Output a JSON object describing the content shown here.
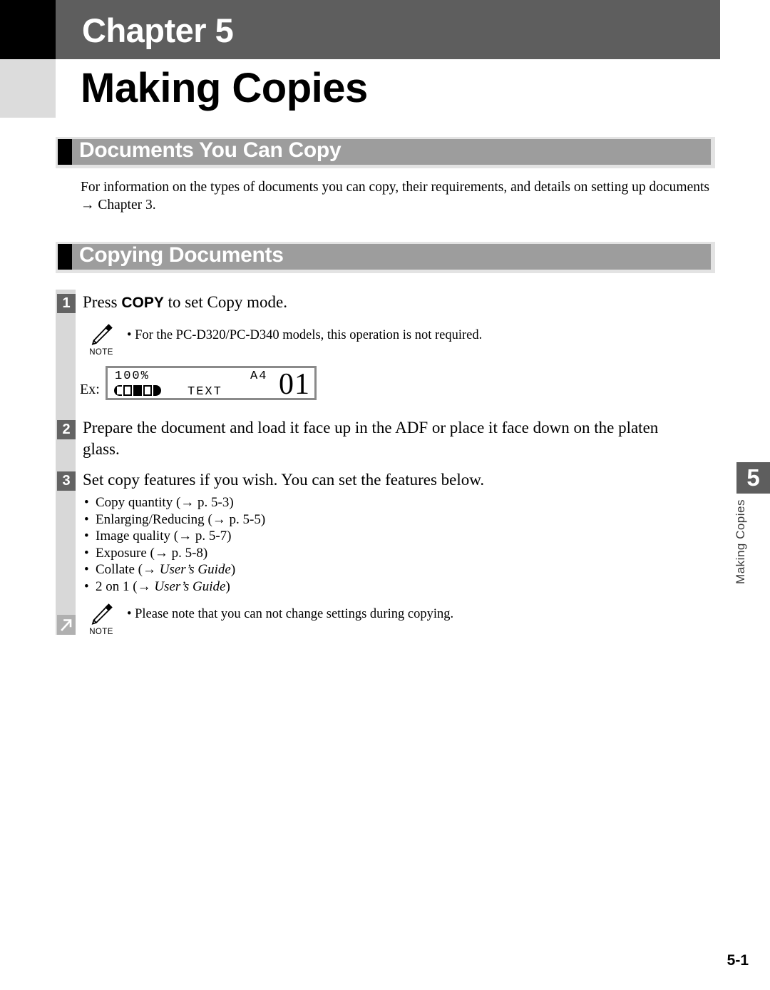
{
  "header": {
    "chapter_label": "Chapter 5",
    "title": "Making Copies"
  },
  "sections": [
    {
      "heading": "Documents You Can Copy",
      "paragraph_line1": "For information on the types of documents you can copy, their requirements, and details on setting up documents",
      "paragraph_line2": "→ Chapter 3."
    },
    {
      "heading": "Copying Documents"
    }
  ],
  "steps": [
    {
      "number": "1",
      "text_before": "Press ",
      "text_bold": "COPY",
      "text_after": " to set Copy mode."
    },
    {
      "number": "2",
      "text": "Prepare the document and load it face up in the ADF or place it face down on the platen glass."
    },
    {
      "number": "3",
      "text": "Set copy features if you wish. You can set the features below."
    }
  ],
  "notes": [
    {
      "icon": "pencil-icon",
      "label": "NOTE",
      "text": "• For the PC-D320/PC-D340 models, this operation is not required."
    },
    {
      "icon": "pencil-icon",
      "label": "NOTE",
      "text": "• Please note that you can not change settings during copying."
    }
  ],
  "lcd_example": {
    "ex_label": "Ex:",
    "zoom_value": "100%",
    "paper_size": "A4",
    "copy_count": "01",
    "image_mode": "TEXT",
    "density_scale": [
      "cap-left",
      "open",
      "filled",
      "open",
      "cap-right"
    ]
  },
  "feature_bullets": [
    {
      "bullet": "•",
      "label": "Copy quantity",
      "ref": "(→ p. 5-3)",
      "ref_italic": false
    },
    {
      "bullet": "•",
      "label": "Enlarging/Reducing",
      "ref": "(→ p. 5-5)",
      "ref_italic": false
    },
    {
      "bullet": "•",
      "label": "Image quality",
      "ref": "(→ p. 5-7)",
      "ref_italic": false
    },
    {
      "bullet": "•",
      "label": "Exposure",
      "ref": "(→ p. 5-8)",
      "ref_italic": false
    },
    {
      "bullet": "•",
      "label": "Collate",
      "ref_prefix": "(→ ",
      "ref_italic_text": "User’s Guide",
      "ref_suffix": ")",
      "ref_italic": true
    },
    {
      "bullet": "•",
      "label": "2 on 1",
      "ref_prefix": "(→ ",
      "ref_italic_text": "User’s Guide",
      "ref_suffix": ")",
      "ref_italic": true
    }
  ],
  "side_tab": {
    "number": "5",
    "label": "Making Copies"
  },
  "footer": {
    "page_number": "5-1"
  },
  "colors": {
    "header_band": "#5e5e5e",
    "heading_bar": "#9d9d9d",
    "step_marker": "#636363",
    "left_strip": "#d8d8d8",
    "corner_gray": "#dcdcdc"
  }
}
